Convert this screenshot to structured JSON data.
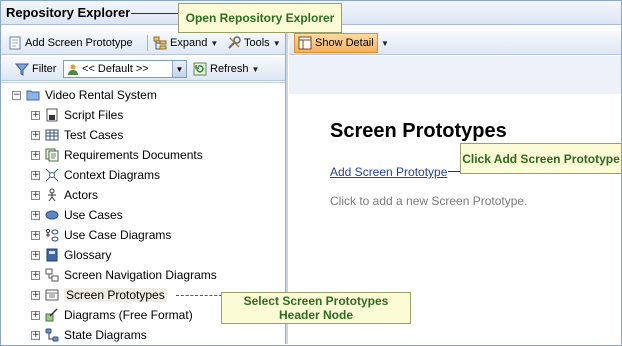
{
  "window": {
    "title": "Repository Explorer"
  },
  "toolbar1": {
    "add_label": "Add Screen Prototype",
    "expand_label": "Expand",
    "tools_label": "Tools"
  },
  "toolbar2": {
    "filter_label": "Filter",
    "filter_value": "<< Default >>",
    "refresh_label": "Refresh"
  },
  "tree": {
    "root": "Video Rental System",
    "items": [
      {
        "label": "Script Files",
        "icon": "script-files-icon"
      },
      {
        "label": "Test Cases",
        "icon": "test-cases-icon"
      },
      {
        "label": "Requirements Documents",
        "icon": "requirements-icon"
      },
      {
        "label": "Context Diagrams",
        "icon": "context-diagram-icon"
      },
      {
        "label": "Actors",
        "icon": "actor-icon"
      },
      {
        "label": "Use Cases",
        "icon": "use-case-icon"
      },
      {
        "label": "Use Case Diagrams",
        "icon": "use-case-diagram-icon"
      },
      {
        "label": "Glossary",
        "icon": "glossary-icon"
      },
      {
        "label": "Screen Navigation Diagrams",
        "icon": "navigation-diagram-icon"
      },
      {
        "label": "Screen Prototypes",
        "icon": "screen-prototype-icon"
      },
      {
        "label": "Diagrams (Free Format)",
        "icon": "free-diagram-icon"
      },
      {
        "label": "State Diagrams",
        "icon": "state-diagram-icon"
      }
    ]
  },
  "right": {
    "show_detail_label": "Show Detail",
    "heading": "Screen Prototypes",
    "add_link": "Add Screen Prototype",
    "hint": "Click to add a new Screen Prototype."
  },
  "callouts": {
    "open_explorer": "Open Repository Explorer",
    "click_add": "Click Add Screen Prototype",
    "select_node": "Select Screen Prototypes Header Node"
  },
  "colors": {
    "callout_bg": "#fbfbd6",
    "callout_text": "#2a6d1f",
    "link": "#1f3fa8",
    "selected_bg": "#efece2"
  }
}
